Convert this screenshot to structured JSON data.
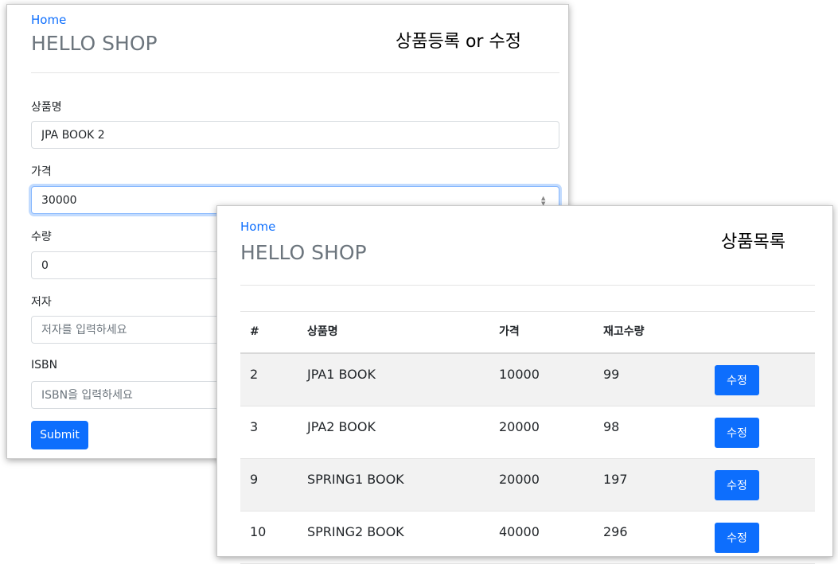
{
  "form_window": {
    "home_link": "Home",
    "shop_title": "HELLO SHOP",
    "caption": "상품등록 or 수정",
    "fields": [
      {
        "label": "상품명",
        "value": "JPA BOOK 2",
        "placeholder": ""
      },
      {
        "label": "가격",
        "value": "30000",
        "placeholder": ""
      },
      {
        "label": "수량",
        "value": "0",
        "placeholder": ""
      },
      {
        "label": "저자",
        "value": "",
        "placeholder": "저자를 입력하세요"
      },
      {
        "label": "ISBN",
        "value": "",
        "placeholder": "ISBN을 입력하세요"
      }
    ],
    "submit_label": "Submit"
  },
  "list_window": {
    "home_link": "Home",
    "shop_title": "HELLO SHOP",
    "caption": "상품목록",
    "columns": [
      "#",
      "상품명",
      "가격",
      "재고수량"
    ],
    "rows": [
      {
        "id": "2",
        "name": "JPA1 BOOK",
        "price": "10000",
        "stock": "99",
        "action": "수정"
      },
      {
        "id": "3",
        "name": "JPA2 BOOK",
        "price": "20000",
        "stock": "98",
        "action": "수정"
      },
      {
        "id": "9",
        "name": "SPRING1 BOOK",
        "price": "20000",
        "stock": "197",
        "action": "수정"
      },
      {
        "id": "10",
        "name": "SPRING2 BOOK",
        "price": "40000",
        "stock": "296",
        "action": "수정"
      }
    ]
  },
  "colors": {
    "primary": "#0d6efd",
    "title_gray": "#6c757d",
    "stripe": "#f2f2f2"
  }
}
